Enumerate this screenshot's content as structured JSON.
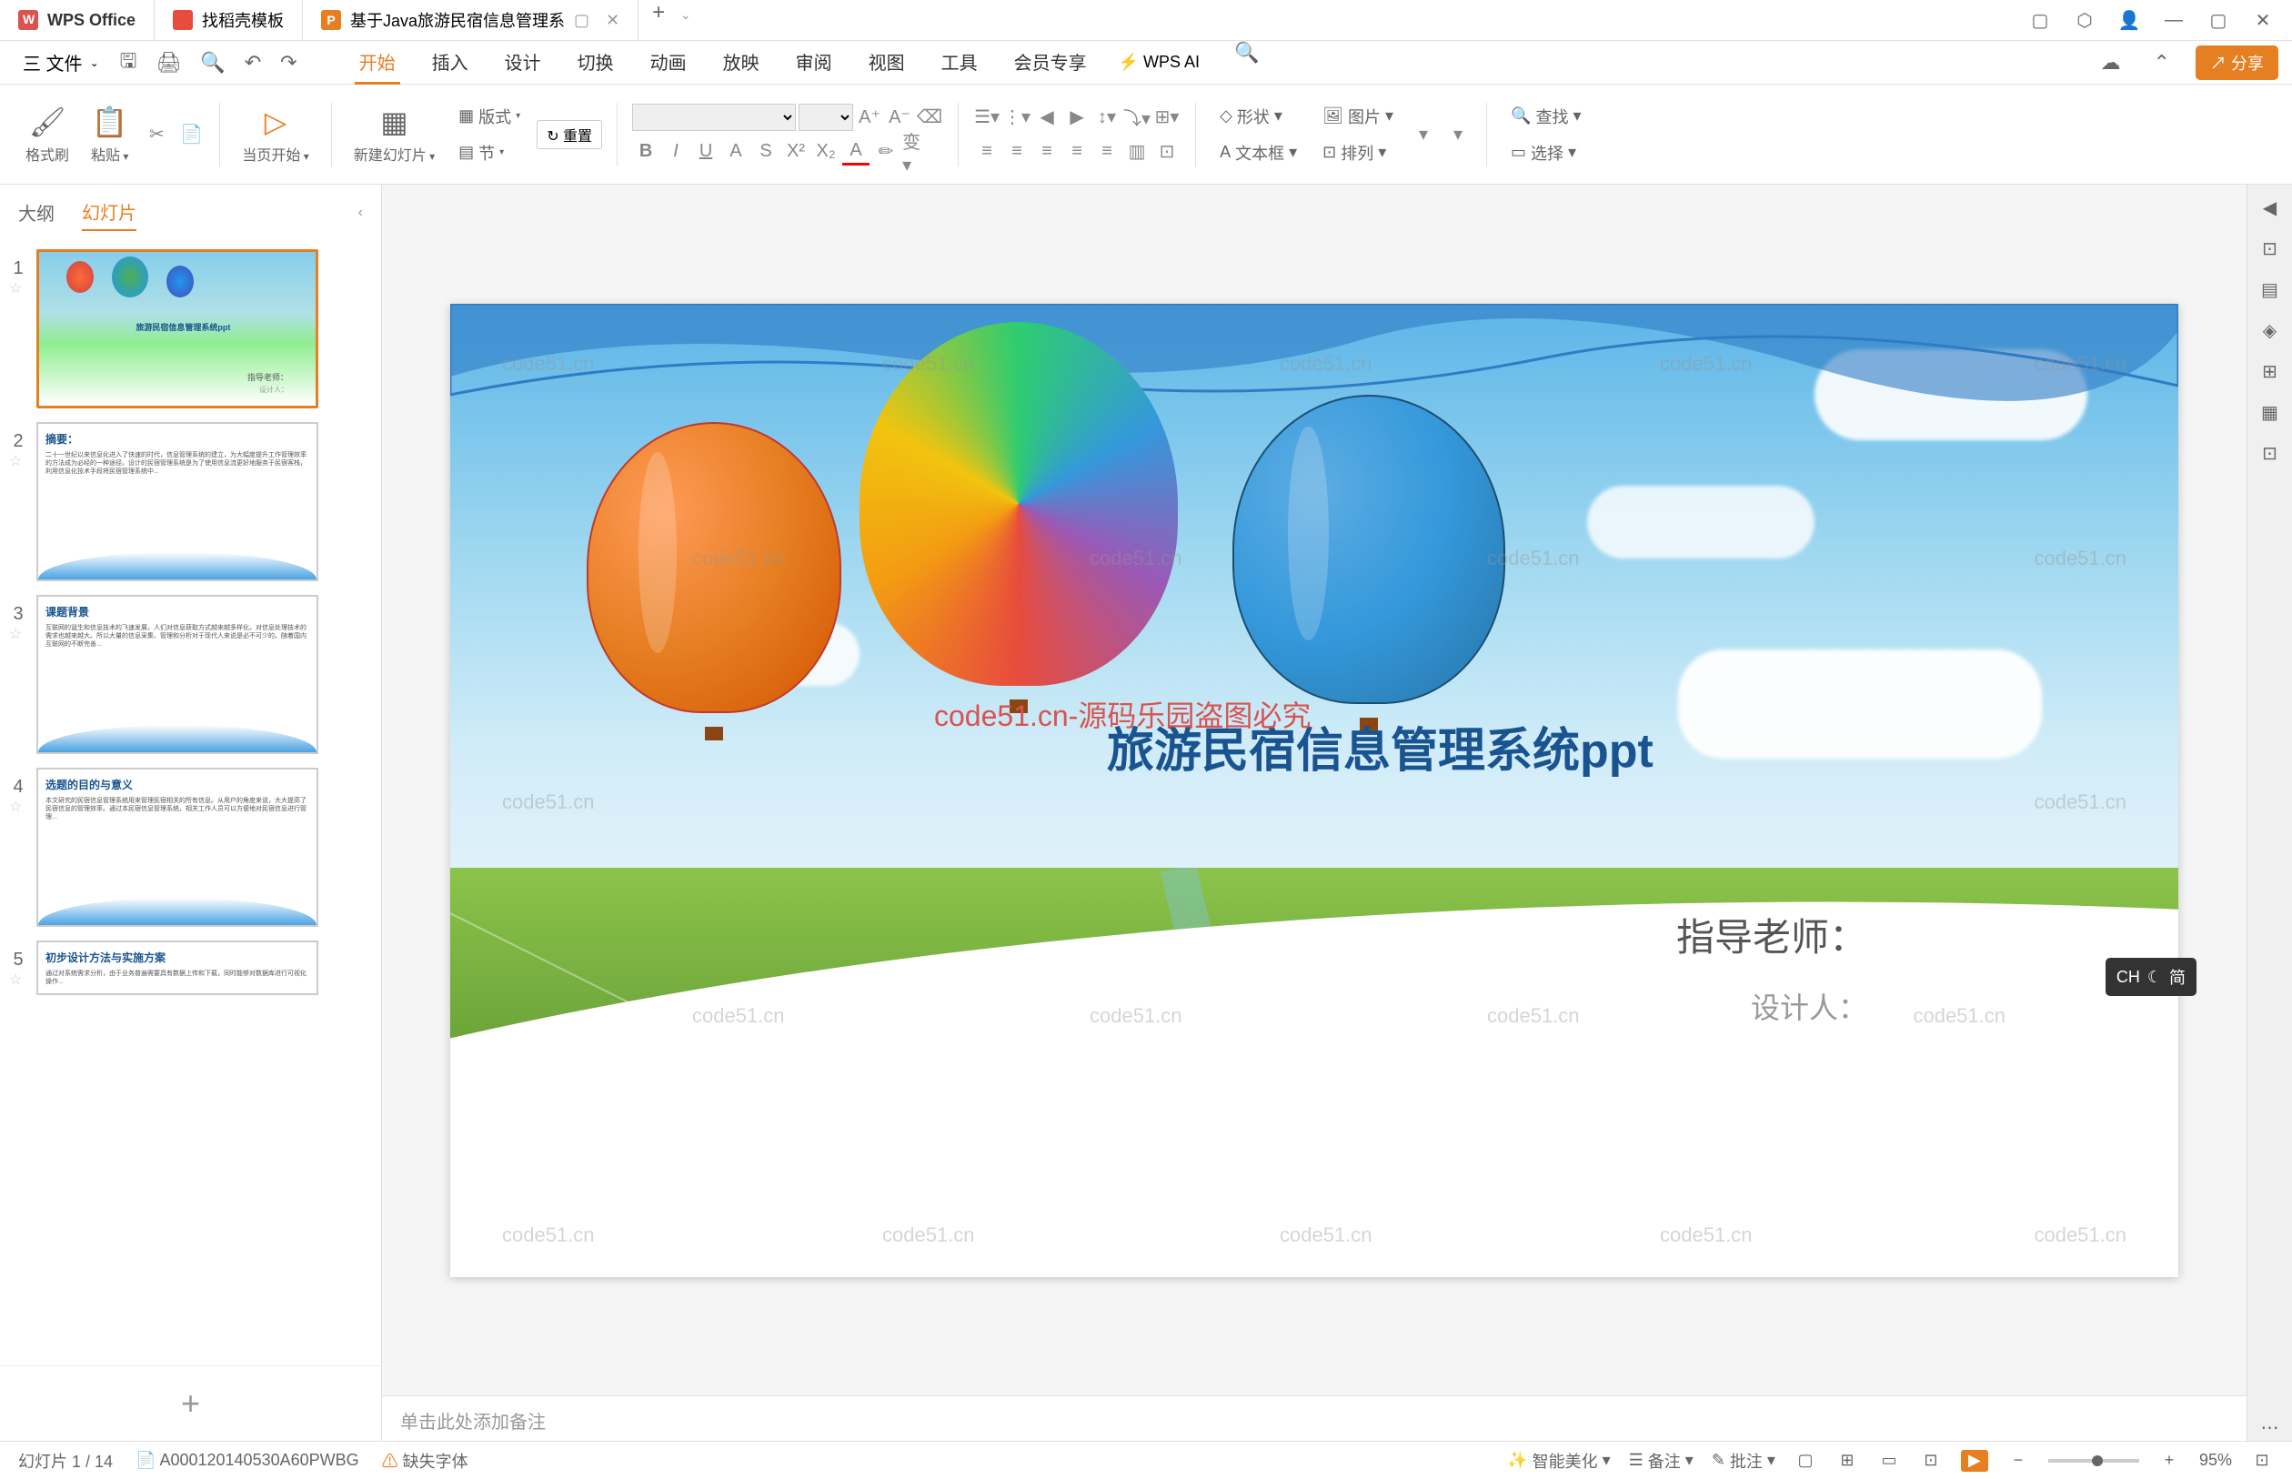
{
  "titleBar": {
    "appName": "WPS Office",
    "docerTab": "找稻壳模板",
    "activeTab": "基于Java旅游民宿信息管理系",
    "newTab": "+"
  },
  "menuBar": {
    "fileMenu": "三 文件",
    "tabs": {
      "start": "开始",
      "insert": "插入",
      "design": "设计",
      "transition": "切换",
      "animation": "动画",
      "slideshow": "放映",
      "review": "审阅",
      "view": "视图",
      "tools": "工具",
      "member": "会员专享"
    },
    "wpsAi": "WPS AI",
    "share": "分享"
  },
  "ribbon": {
    "formatPainter": "格式刷",
    "paste": "粘贴",
    "fromCurrent": "当页开始",
    "newSlide": "新建幻灯片",
    "layout": "版式",
    "section": "节",
    "reset": "重置",
    "shape": "形状",
    "picture": "图片",
    "textbox": "文本框",
    "arrange": "排列",
    "find": "查找",
    "select": "选择"
  },
  "slidePanel": {
    "outlineTab": "大纲",
    "slidesTab": "幻灯片",
    "slides": [
      {
        "num": "1",
        "title": "旅游民宿信息管理系统ppt",
        "teacher": "指导老师：",
        "designer": "设计人："
      },
      {
        "num": "2",
        "heading": "摘要："
      },
      {
        "num": "3",
        "heading": "课题背景"
      },
      {
        "num": "4",
        "heading": "选题的目的与意义"
      },
      {
        "num": "5",
        "heading": "初步设计方法与实施方案"
      }
    ]
  },
  "mainSlide": {
    "title": "旅游民宿信息管理系统ppt",
    "teacher": "指导老师：",
    "designer": "设计人：",
    "watermarkCenter": "code51.cn-源码乐园盗图必究",
    "watermark": "code51.cn"
  },
  "notes": {
    "placeholder": "单击此处添加备注"
  },
  "statusBar": {
    "slideCount": "幻灯片 1 / 14",
    "fileId": "A000120140530A60PWBG",
    "fontWarning": "缺失字体",
    "beautify": "智能美化",
    "notes": "备注",
    "comments": "批注",
    "zoom": "95%"
  },
  "ime": {
    "label": "CH",
    "suffix": "简"
  }
}
